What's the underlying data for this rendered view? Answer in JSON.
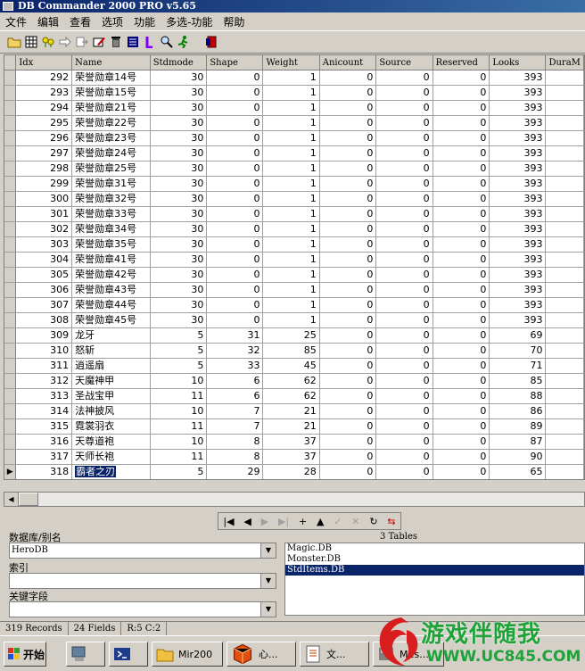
{
  "window": {
    "title": "DB Commander 2000 PRO v5.65"
  },
  "menu": [
    "文件",
    "编辑",
    "查看",
    "选项",
    "功能",
    "多选-功能",
    "帮助"
  ],
  "grid": {
    "columns": [
      "Idx",
      "Name",
      "Stdmode",
      "Shape",
      "Weight",
      "Anicount",
      "Source",
      "Reserved",
      "Looks",
      "DuraM"
    ],
    "rows": [
      [
        "292",
        "荣誉勋章14号",
        "30",
        "0",
        "1",
        "0",
        "0",
        "0",
        "393"
      ],
      [
        "293",
        "荣誉勋章15号",
        "30",
        "0",
        "1",
        "0",
        "0",
        "0",
        "393"
      ],
      [
        "294",
        "荣誉勋章21号",
        "30",
        "0",
        "1",
        "0",
        "0",
        "0",
        "393"
      ],
      [
        "295",
        "荣誉勋章22号",
        "30",
        "0",
        "1",
        "0",
        "0",
        "0",
        "393"
      ],
      [
        "296",
        "荣誉勋章23号",
        "30",
        "0",
        "1",
        "0",
        "0",
        "0",
        "393"
      ],
      [
        "297",
        "荣誉勋章24号",
        "30",
        "0",
        "1",
        "0",
        "0",
        "0",
        "393"
      ],
      [
        "298",
        "荣誉勋章25号",
        "30",
        "0",
        "1",
        "0",
        "0",
        "0",
        "393"
      ],
      [
        "299",
        "荣誉勋章31号",
        "30",
        "0",
        "1",
        "0",
        "0",
        "0",
        "393"
      ],
      [
        "300",
        "荣誉勋章32号",
        "30",
        "0",
        "1",
        "0",
        "0",
        "0",
        "393"
      ],
      [
        "301",
        "荣誉勋章33号",
        "30",
        "0",
        "1",
        "0",
        "0",
        "0",
        "393"
      ],
      [
        "302",
        "荣誉勋章34号",
        "30",
        "0",
        "1",
        "0",
        "0",
        "0",
        "393"
      ],
      [
        "303",
        "荣誉勋章35号",
        "30",
        "0",
        "1",
        "0",
        "0",
        "0",
        "393"
      ],
      [
        "304",
        "荣誉勋章41号",
        "30",
        "0",
        "1",
        "0",
        "0",
        "0",
        "393"
      ],
      [
        "305",
        "荣誉勋章42号",
        "30",
        "0",
        "1",
        "0",
        "0",
        "0",
        "393"
      ],
      [
        "306",
        "荣誉勋章43号",
        "30",
        "0",
        "1",
        "0",
        "0",
        "0",
        "393"
      ],
      [
        "307",
        "荣誉勋章44号",
        "30",
        "0",
        "1",
        "0",
        "0",
        "0",
        "393"
      ],
      [
        "308",
        "荣誉勋章45号",
        "30",
        "0",
        "1",
        "0",
        "0",
        "0",
        "393"
      ],
      [
        "309",
        "龙牙",
        "5",
        "31",
        "25",
        "0",
        "0",
        "0",
        "69"
      ],
      [
        "310",
        "怒斩",
        "5",
        "32",
        "85",
        "0",
        "0",
        "0",
        "70"
      ],
      [
        "311",
        "逍遥扇",
        "5",
        "33",
        "45",
        "0",
        "0",
        "0",
        "71"
      ],
      [
        "312",
        "天魔神甲",
        "10",
        "6",
        "62",
        "0",
        "0",
        "0",
        "85"
      ],
      [
        "313",
        "圣战宝甲",
        "11",
        "6",
        "62",
        "0",
        "0",
        "0",
        "88"
      ],
      [
        "314",
        "法神披风",
        "10",
        "7",
        "21",
        "0",
        "0",
        "0",
        "86"
      ],
      [
        "315",
        "霓裳羽衣",
        "11",
        "7",
        "21",
        "0",
        "0",
        "0",
        "89"
      ],
      [
        "316",
        "天尊道袍",
        "10",
        "8",
        "37",
        "0",
        "0",
        "0",
        "87"
      ],
      [
        "317",
        "天师长袍",
        "11",
        "8",
        "37",
        "0",
        "0",
        "0",
        "90"
      ],
      [
        "318",
        "霸者之刃",
        "5",
        "29",
        "28",
        "0",
        "0",
        "0",
        "65"
      ]
    ],
    "current_row_index": 26
  },
  "navigator": {
    "first": "|◀",
    "prior": "◀",
    "next": "▶",
    "last": "▶|",
    "insert": "+",
    "delete": "▲",
    "post": "✓",
    "cancel": "✕",
    "refresh": "↻"
  },
  "bottom": {
    "db_label": "数据库/别名",
    "db_value": "HeroDB",
    "index_label": "索引",
    "index_value": "",
    "key_label": "关键字段",
    "key_value": "",
    "tables_count": "3 Tables",
    "tables": [
      "Magic.DB",
      "Monster.DB",
      "StdItems.DB"
    ],
    "selected_table": "StdItems.DB"
  },
  "status": {
    "records": "319 Records",
    "fields": "24 Fields",
    "pos": "R:5 C:2"
  },
  "taskbar": {
    "start_label": "开始",
    "tasks": [
      "",
      "",
      "",
      "Mir200",
      "心...",
      "文...",
      "M2s..."
    ]
  },
  "watermark": {
    "text": "游戏伴随我",
    "url": "WWW.UC845.COM"
  },
  "colors": {
    "selection": "#0a246a",
    "face": "#d4d0c8",
    "watermark": "#1fa339"
  }
}
